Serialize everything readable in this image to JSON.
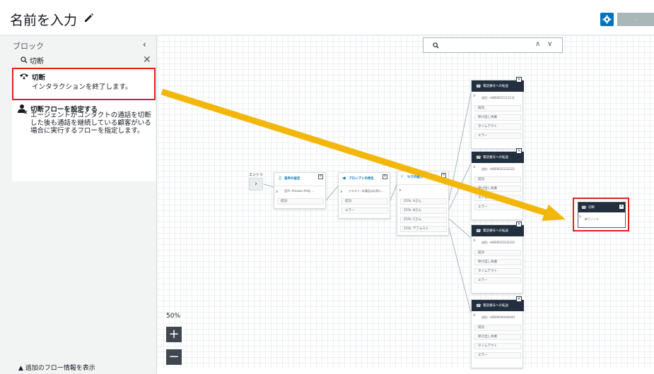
{
  "header": {
    "title": "名前を入力",
    "gray_button_label": "-"
  },
  "sidebar": {
    "heading": "ブロック",
    "collapse_glyph": "‹",
    "search_value": "切断",
    "clear_glyph": "✕",
    "blocks": [
      {
        "title": "切断",
        "description": "インタラクションを終了します。"
      },
      {
        "title": "切断フローを設定する",
        "description": "エージェントがコンタクトの通話を切断した後も通話を継続している顧客がいる場合に実行するフローを指定します。"
      }
    ],
    "more_info": "追加のフロー情報を表示"
  },
  "canvas_search": {
    "prev": "∧",
    "next": "∨"
  },
  "zoom": {
    "level": "50%",
    "plus": "+",
    "minus": "−"
  },
  "entry": {
    "label": "エントリ",
    "glyph": "›"
  },
  "nodes": {
    "voice": {
      "title": "音声の設定",
      "sub": "音声: Amazon Polly ...",
      "branches": [
        "成功"
      ]
    },
    "prompt": {
      "title": "プロンプトの再生",
      "sub": "テキスト: 本通話はお問い...",
      "branches": [
        "成功",
        "エラー"
      ]
    },
    "distribute": {
      "title": "%での配分",
      "branches": [
        "25%: Aさん",
        "25%: Bさん",
        "25%: Cさん",
        "25%: デフォルト"
      ]
    },
    "transfers": [
      {
        "title": "電話番号への転送",
        "sub": "送信: +8000011111111",
        "branches": [
          "成功",
          "呼び出し失敗",
          "タイムアウト",
          "エラー"
        ]
      },
      {
        "title": "電話番号への転送",
        "sub": "送信: +8000022222222",
        "branches": [
          "成功",
          "呼び出し失敗",
          "タイムアウト",
          "エラー"
        ]
      },
      {
        "title": "電話番号への転送",
        "sub": "送信: +8000033333333",
        "branches": [
          "成功",
          "呼び出し失敗",
          "タイムアウト",
          "エラー"
        ]
      },
      {
        "title": "電話番号への転送",
        "sub": "送信: +8000044444444",
        "branches": [
          "成功",
          "呼び出し失敗",
          "タイムアウト",
          "エラー"
        ]
      }
    ],
    "hangup": {
      "title": "切断",
      "sub": "終了ノード"
    }
  },
  "colors": {
    "accent": "#0073bb",
    "highlight": "#e02020",
    "arrow": "#f2b70a",
    "node_head_dark": "#232f3e"
  }
}
